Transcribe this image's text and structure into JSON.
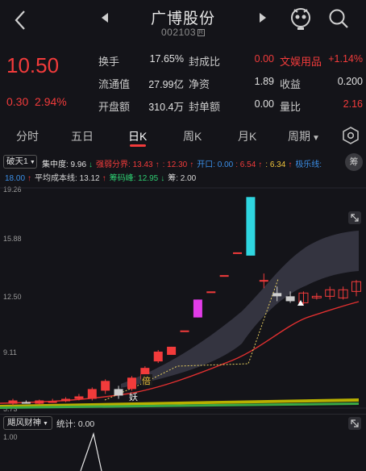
{
  "header": {
    "title": "广博股份",
    "code": "002103",
    "code_badge": "R"
  },
  "quote": {
    "price": "10.50",
    "change": "0.30",
    "change_pct": "2.94%",
    "rows": [
      {
        "l1": "换手",
        "v1": "17.65%",
        "l2": "封成比",
        "v2": "0.00",
        "l3": "文娱用品",
        "v3": "+1.14%"
      },
      {
        "l1": "流通值",
        "v1": "27.99亿",
        "l2": "净资",
        "v2": "1.89",
        "l3": "收益",
        "v3": "0.200"
      },
      {
        "l1": "开盘额",
        "v1": "310.4万",
        "l2": "封单额",
        "v2": "0.00",
        "l3": "量比",
        "v3": "2.16"
      }
    ]
  },
  "tabs": [
    "分时",
    "五日",
    "日K",
    "周K",
    "月K",
    "周期"
  ],
  "active_tab": "日K",
  "indicators": {
    "selector": "破天1",
    "line1": [
      {
        "t": "集中度: 9.96",
        "c": "#e0e0e0",
        "arrow": "↓",
        "ac": "#2ecc71"
      },
      {
        "t": "强弱分界: 13.43",
        "c": "#f23b3b",
        "arrow": "↑",
        "ac": "#f23b3b"
      },
      {
        "t": ": 12.30",
        "c": "#f23b3b",
        "arrow": "↑",
        "ac": "#f23b3b"
      },
      {
        "t": "开口: 0.00",
        "c": "#3b8fe8",
        "arrow": "",
        "ac": ""
      },
      {
        "t": ": 6.54",
        "c": "#f23b3b",
        "arrow": "↑",
        "ac": "#f23b3b"
      },
      {
        "t": ": 6.34",
        "c": "#f2c53b",
        "arrow": "↑",
        "ac": "#f23b3b"
      },
      {
        "t": "极乐线:",
        "c": "#3b8fe8",
        "arrow": "",
        "ac": ""
      }
    ],
    "line2": [
      {
        "t": "18.00",
        "c": "#3b8fe8",
        "arrow": "↑",
        "ac": "#f23b3b"
      },
      {
        "t": "平均成本线: 13.12",
        "c": "#d6d6d6",
        "arrow": "↑",
        "ac": "#f23b3b"
      },
      {
        "t": "筹码峰: 12.95",
        "c": "#2ecc71",
        "arrow": "↓",
        "ac": "#2ecc71"
      },
      {
        "t": "筹: 2.00",
        "c": "#d6d6d6",
        "arrow": "",
        "ac": ""
      }
    ],
    "chou_label": "筹"
  },
  "chart_data": {
    "type": "candlestick",
    "y_ticks": [
      "19.26",
      "15.88",
      "12.50",
      "9.11",
      "5.73"
    ],
    "ylim": [
      5.73,
      19.26
    ],
    "annotations": [
      "倍",
      "妖"
    ],
    "candles": [
      {
        "o": 6.0,
        "c": 6.2,
        "h": 6.3,
        "l": 5.9
      },
      {
        "o": 6.1,
        "c": 6.05,
        "h": 6.2,
        "l": 6.0
      },
      {
        "o": 6.0,
        "c": 6.2,
        "h": 6.25,
        "l": 5.95
      },
      {
        "o": 6.1,
        "c": 6.15,
        "h": 6.3,
        "l": 6.05
      },
      {
        "o": 6.15,
        "c": 6.3,
        "h": 6.4,
        "l": 6.1
      },
      {
        "o": 6.3,
        "c": 6.45,
        "h": 6.6,
        "l": 6.2
      },
      {
        "o": 6.3,
        "c": 6.9,
        "h": 7.0,
        "l": 6.2
      },
      {
        "o": 6.8,
        "c": 7.4,
        "h": 7.5,
        "l": 6.6
      },
      {
        "o": 6.9,
        "c": 6.5,
        "h": 7.1,
        "l": 6.3
      },
      {
        "o": 6.9,
        "c": 7.6,
        "h": 7.7,
        "l": 6.8
      },
      {
        "o": 7.5,
        "c": 8.2,
        "h": 8.3,
        "l": 7.4
      },
      {
        "o": 8.6,
        "c": 9.2,
        "h": 9.3,
        "l": 8.5
      },
      {
        "o": 9.0,
        "c": 9.5,
        "h": 9.5,
        "l": 9.0
      },
      {
        "o": 10.5,
        "c": 10.5,
        "h": 10.5,
        "l": 10.5
      },
      {
        "o": 11.3,
        "c": 12.4,
        "h": 12.4,
        "l": 11.3
      },
      {
        "o": 12.9,
        "c": 12.9,
        "h": 12.9,
        "l": 12.9
      },
      {
        "o": 13.9,
        "c": 13.9,
        "h": 13.9,
        "l": 13.9
      },
      {
        "o": 15.3,
        "c": 15.3,
        "h": 15.3,
        "l": 15.3
      },
      {
        "o": 15.1,
        "c": 18.7,
        "h": 18.7,
        "l": 15.1
      },
      {
        "o": 13.6,
        "c": 13.6,
        "h": 14.0,
        "l": 13.1
      },
      {
        "o": 12.8,
        "c": 12.6,
        "h": 13.2,
        "l": 12.3
      },
      {
        "o": 12.6,
        "c": 12.3,
        "h": 12.9,
        "l": 12.2
      },
      {
        "o": 12.2,
        "c": 12.8,
        "h": 12.9,
        "l": 12.1
      },
      {
        "o": 12.5,
        "c": 12.6,
        "h": 12.8,
        "l": 12.4
      },
      {
        "o": 12.6,
        "c": 13.0,
        "h": 13.2,
        "l": 12.4
      },
      {
        "o": 12.5,
        "c": 13.0,
        "h": 13.2,
        "l": 12.4
      },
      {
        "o": 12.9,
        "c": 13.5,
        "h": 13.6,
        "l": 12.6
      }
    ]
  },
  "sub_panel": {
    "selector": "飓风财神",
    "stat_label": "统计: 0.00",
    "y_top": "1.00"
  }
}
